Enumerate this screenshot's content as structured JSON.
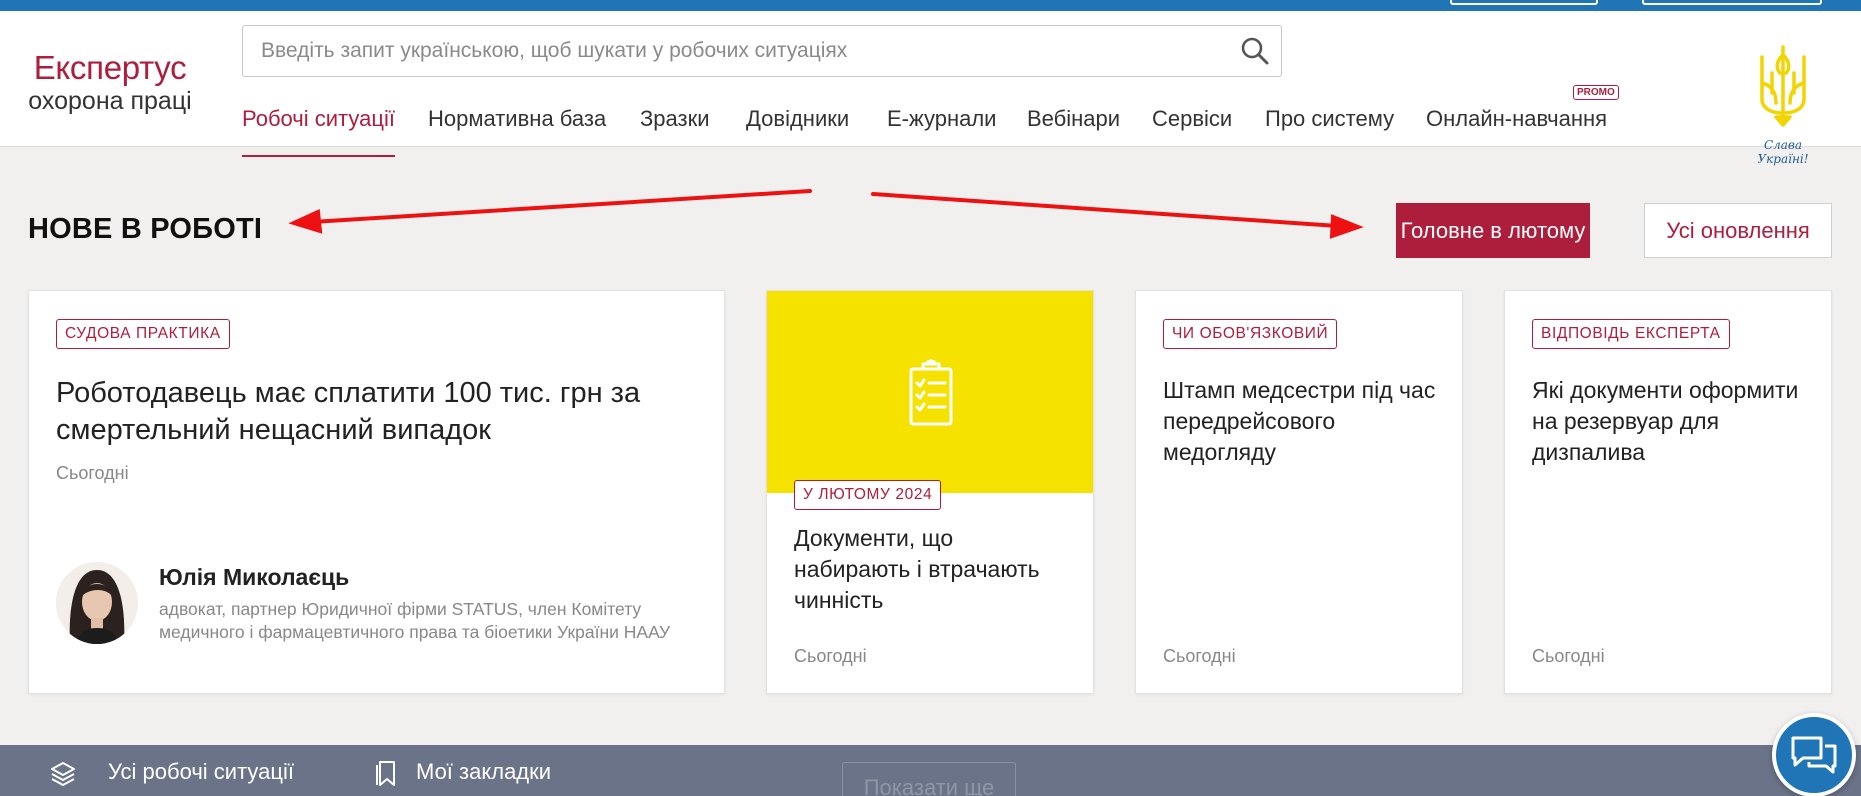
{
  "colors": {
    "accent": "#ad1e3c",
    "topbar": "#1f75b5",
    "yellow": "#f5e200",
    "bottombar": "#6b7388"
  },
  "logo": {
    "line1": "Експертус",
    "line2": "охорона праці"
  },
  "search": {
    "placeholder": "Введіть запит українською, щоб шукати у робочих ситуаціях",
    "value": "",
    "icon": "search-icon"
  },
  "nav": {
    "items": [
      {
        "label": "Робочі ситуації",
        "active": true
      },
      {
        "label": "Нормативна база"
      },
      {
        "label": "Зразки"
      },
      {
        "label": "Довідники"
      },
      {
        "label": "Е-журнали"
      },
      {
        "label": "Вебінари"
      },
      {
        "label": "Сервіси"
      },
      {
        "label": "Про систему"
      },
      {
        "label": "Онлайн-навчання",
        "badge": "PROMO"
      }
    ]
  },
  "emblem": {
    "caption": "Слава Україні!"
  },
  "section": {
    "title": "НОВЕ В РОБОТІ",
    "buttons": {
      "main": "Головне в лютому",
      "all": "Усі оновлення"
    }
  },
  "cards": [
    {
      "tag": "СУДОВА ПРАКТИКА",
      "title": "Роботодавець має сплатити 100 тис. грн за смертельний нещасний випадок",
      "date": "Сьогодні",
      "author": {
        "name": "Юлія Миколаєць",
        "description": "адвокат, партнер Юридичної фірми STATUS, член Комітету медичного і фармацевтичного права та біоетики України НААУ"
      }
    },
    {
      "tag": "У ЛЮТОМУ 2024",
      "title": "Документи, що набирають і втрачають чинність",
      "date": "Сьогодні",
      "icon": "clipboard-checklist-icon"
    },
    {
      "tag": "ЧИ ОБОВ'ЯЗКОВИЙ",
      "title": "Штамп медсестри під час передрейсового медогляду",
      "date": "Сьогодні"
    },
    {
      "tag": "ВІДПОВІДЬ ЕКСПЕРТА",
      "title": "Які документи оформити на резервуар для дизпалива",
      "date": "Сьогодні"
    }
  ],
  "bottombar": {
    "items": [
      {
        "label": "Усі робочі ситуації",
        "icon": "layers-icon"
      },
      {
        "label": "Мої закладки",
        "icon": "bookmark-icon"
      }
    ],
    "show_more": "Показати ще"
  },
  "chat": {
    "icon": "chat-icon"
  }
}
